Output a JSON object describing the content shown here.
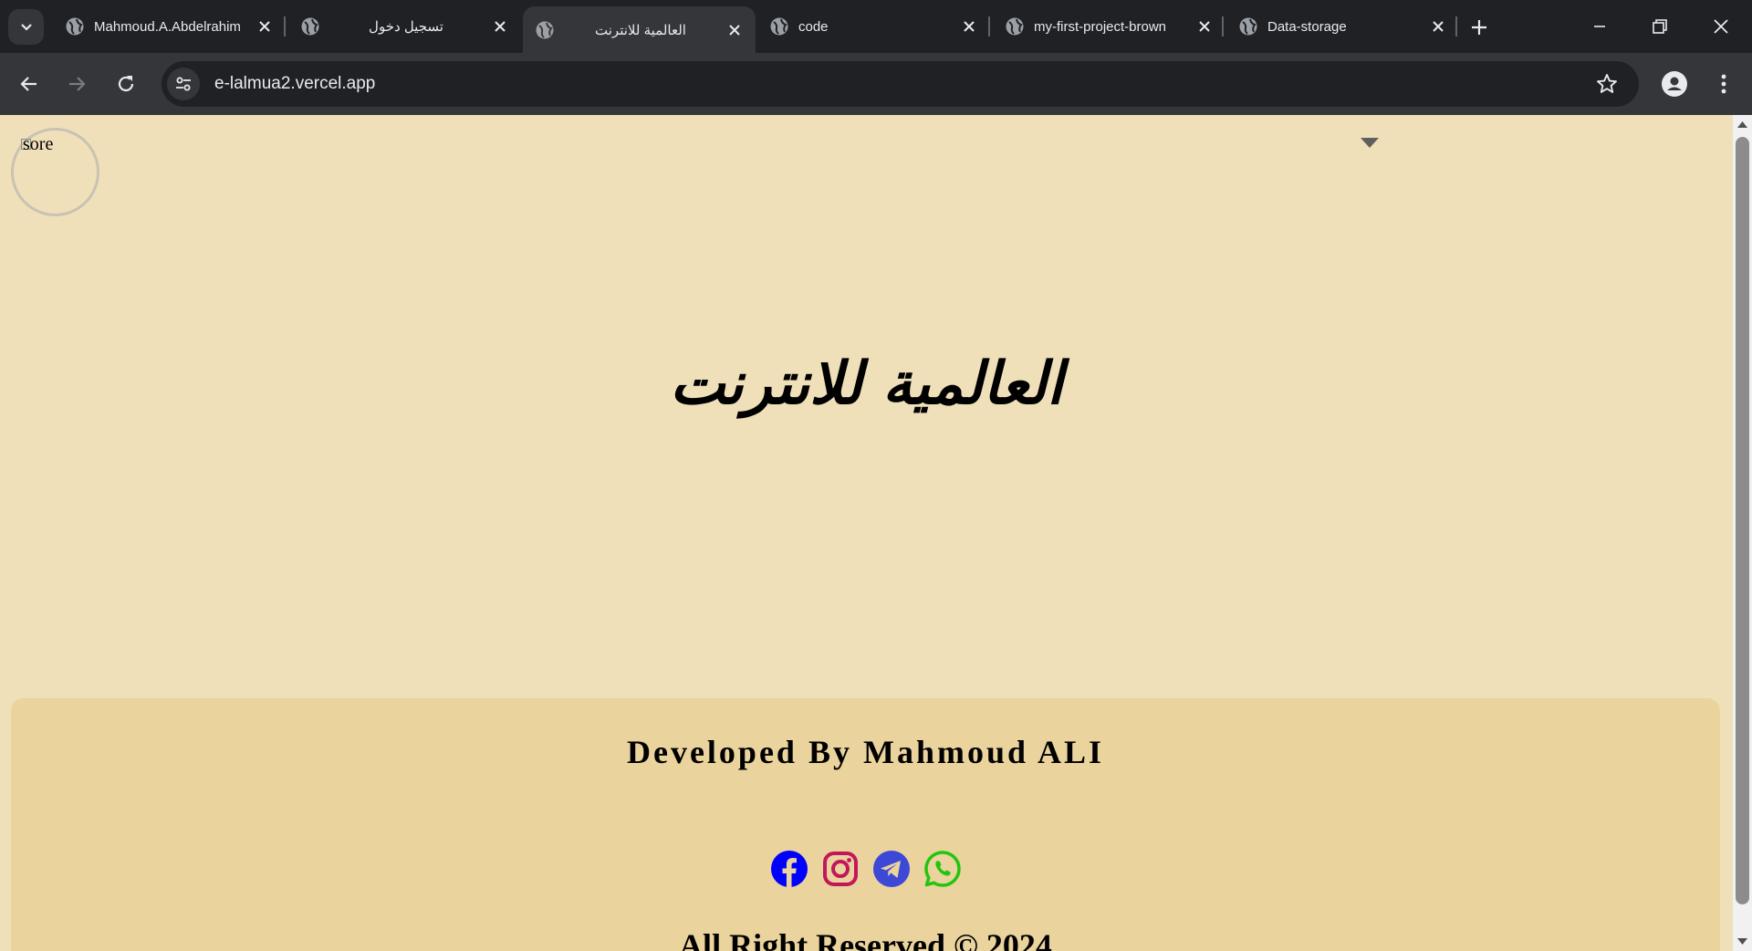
{
  "browser": {
    "tabs": [
      {
        "title": "Mahmoud.A.Abdelrahim",
        "active": false,
        "rtl": false
      },
      {
        "title": "تسجيل دخول",
        "active": false,
        "rtl": true
      },
      {
        "title": "العالمية للانترنت",
        "active": true,
        "rtl": true
      },
      {
        "title": "code",
        "active": false,
        "rtl": false
      },
      {
        "title": "my-first-project-brown",
        "active": false,
        "rtl": false
      },
      {
        "title": "Data-storage",
        "active": false,
        "rtl": false
      }
    ],
    "url": "e-lalmua2.vercel.app"
  },
  "page": {
    "logo_alt": "sore",
    "hero_title": "العالمية للانترنت",
    "footer": {
      "developed_by": "Developed By Mahmoud ALI",
      "rights": "All Right Reserved © 2024",
      "socials": [
        {
          "name": "facebook-icon",
          "color": "#0000ff"
        },
        {
          "name": "instagram-icon",
          "color": "#c2185b"
        },
        {
          "name": "telegram-icon",
          "color": "#3d48d6"
        },
        {
          "name": "whatsapp-icon",
          "color": "#22c50e"
        }
      ]
    }
  }
}
